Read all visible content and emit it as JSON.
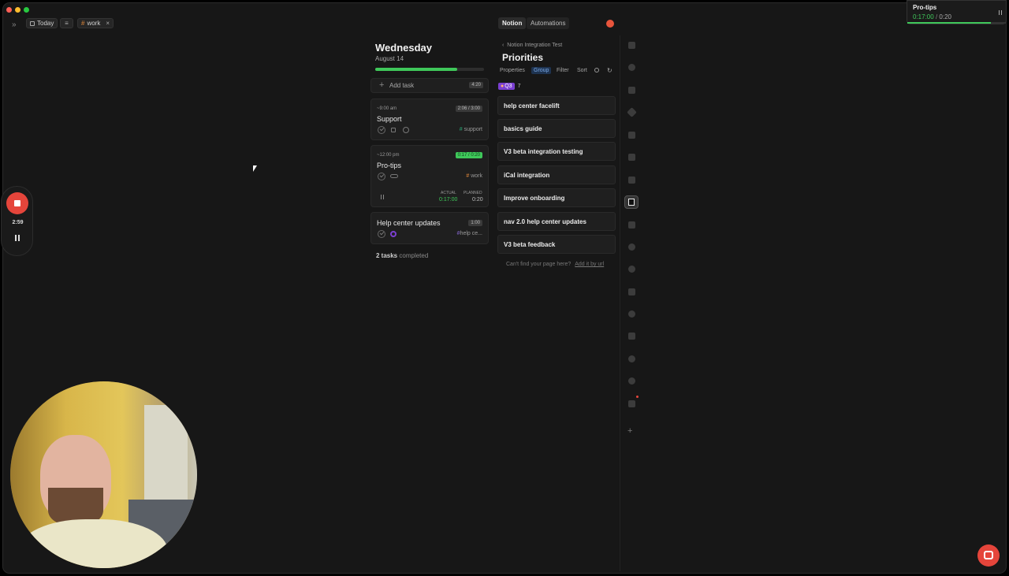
{
  "window": {
    "traffic_lights": [
      "close",
      "minimize",
      "zoom"
    ]
  },
  "topbar": {
    "expand_icon": "double-chevron-right-icon",
    "today_label": "Today",
    "filter_icon": "filter-icon",
    "work_filter": "work",
    "notion_tab": "Notion",
    "automations_tab": "Automations"
  },
  "day": {
    "weekday": "Wednesday",
    "date": "August 14",
    "progress": 0.75,
    "add_task": "Add task",
    "add_task_time": "4:20",
    "completed_count": "2 tasks",
    "completed_label": "completed"
  },
  "tasks": [
    {
      "start": "~9:00 am",
      "title": "Support",
      "time": "2:06 / 3:00",
      "tag": "support"
    },
    {
      "start": "~12:00 pm",
      "title": "Pro-tips",
      "time": "0:17 / 0:20",
      "tag": "work",
      "actual_label": "ACTUAL",
      "actual": "0:17:00",
      "planned_label": "PLANNED",
      "planned": "0:20"
    },
    {
      "title": "Help center updates",
      "time": "1:00",
      "tag": "help ce..."
    }
  ],
  "notion": {
    "breadcrumb": "Notion Integration Test",
    "title": "Priorities",
    "toolbar": [
      "Properties",
      "Group",
      "Filter",
      "Sort"
    ],
    "group_name": "Q3",
    "group_count": "7",
    "items": [
      "help center facelift",
      "basics guide",
      "V3 beta integration testing",
      "iCal integration",
      "Improve onboarding",
      "nav 2.0 help center updates",
      "V3 beta feedback"
    ],
    "footer_text": "Can't find your page here?",
    "footer_link": "Add it by url"
  },
  "recorder": {
    "time": "2:59"
  },
  "timer_popup": {
    "title": "Pro-tips",
    "elapsed": "0:17:00",
    "separator": "/",
    "planned": "0:20",
    "progress": 0.85
  },
  "colors": {
    "accent_green": "#3fc85a",
    "record_red": "#e5453b",
    "group_purple": "#7b3fd1",
    "bg": "#171717",
    "card": "#1f1f1f"
  }
}
